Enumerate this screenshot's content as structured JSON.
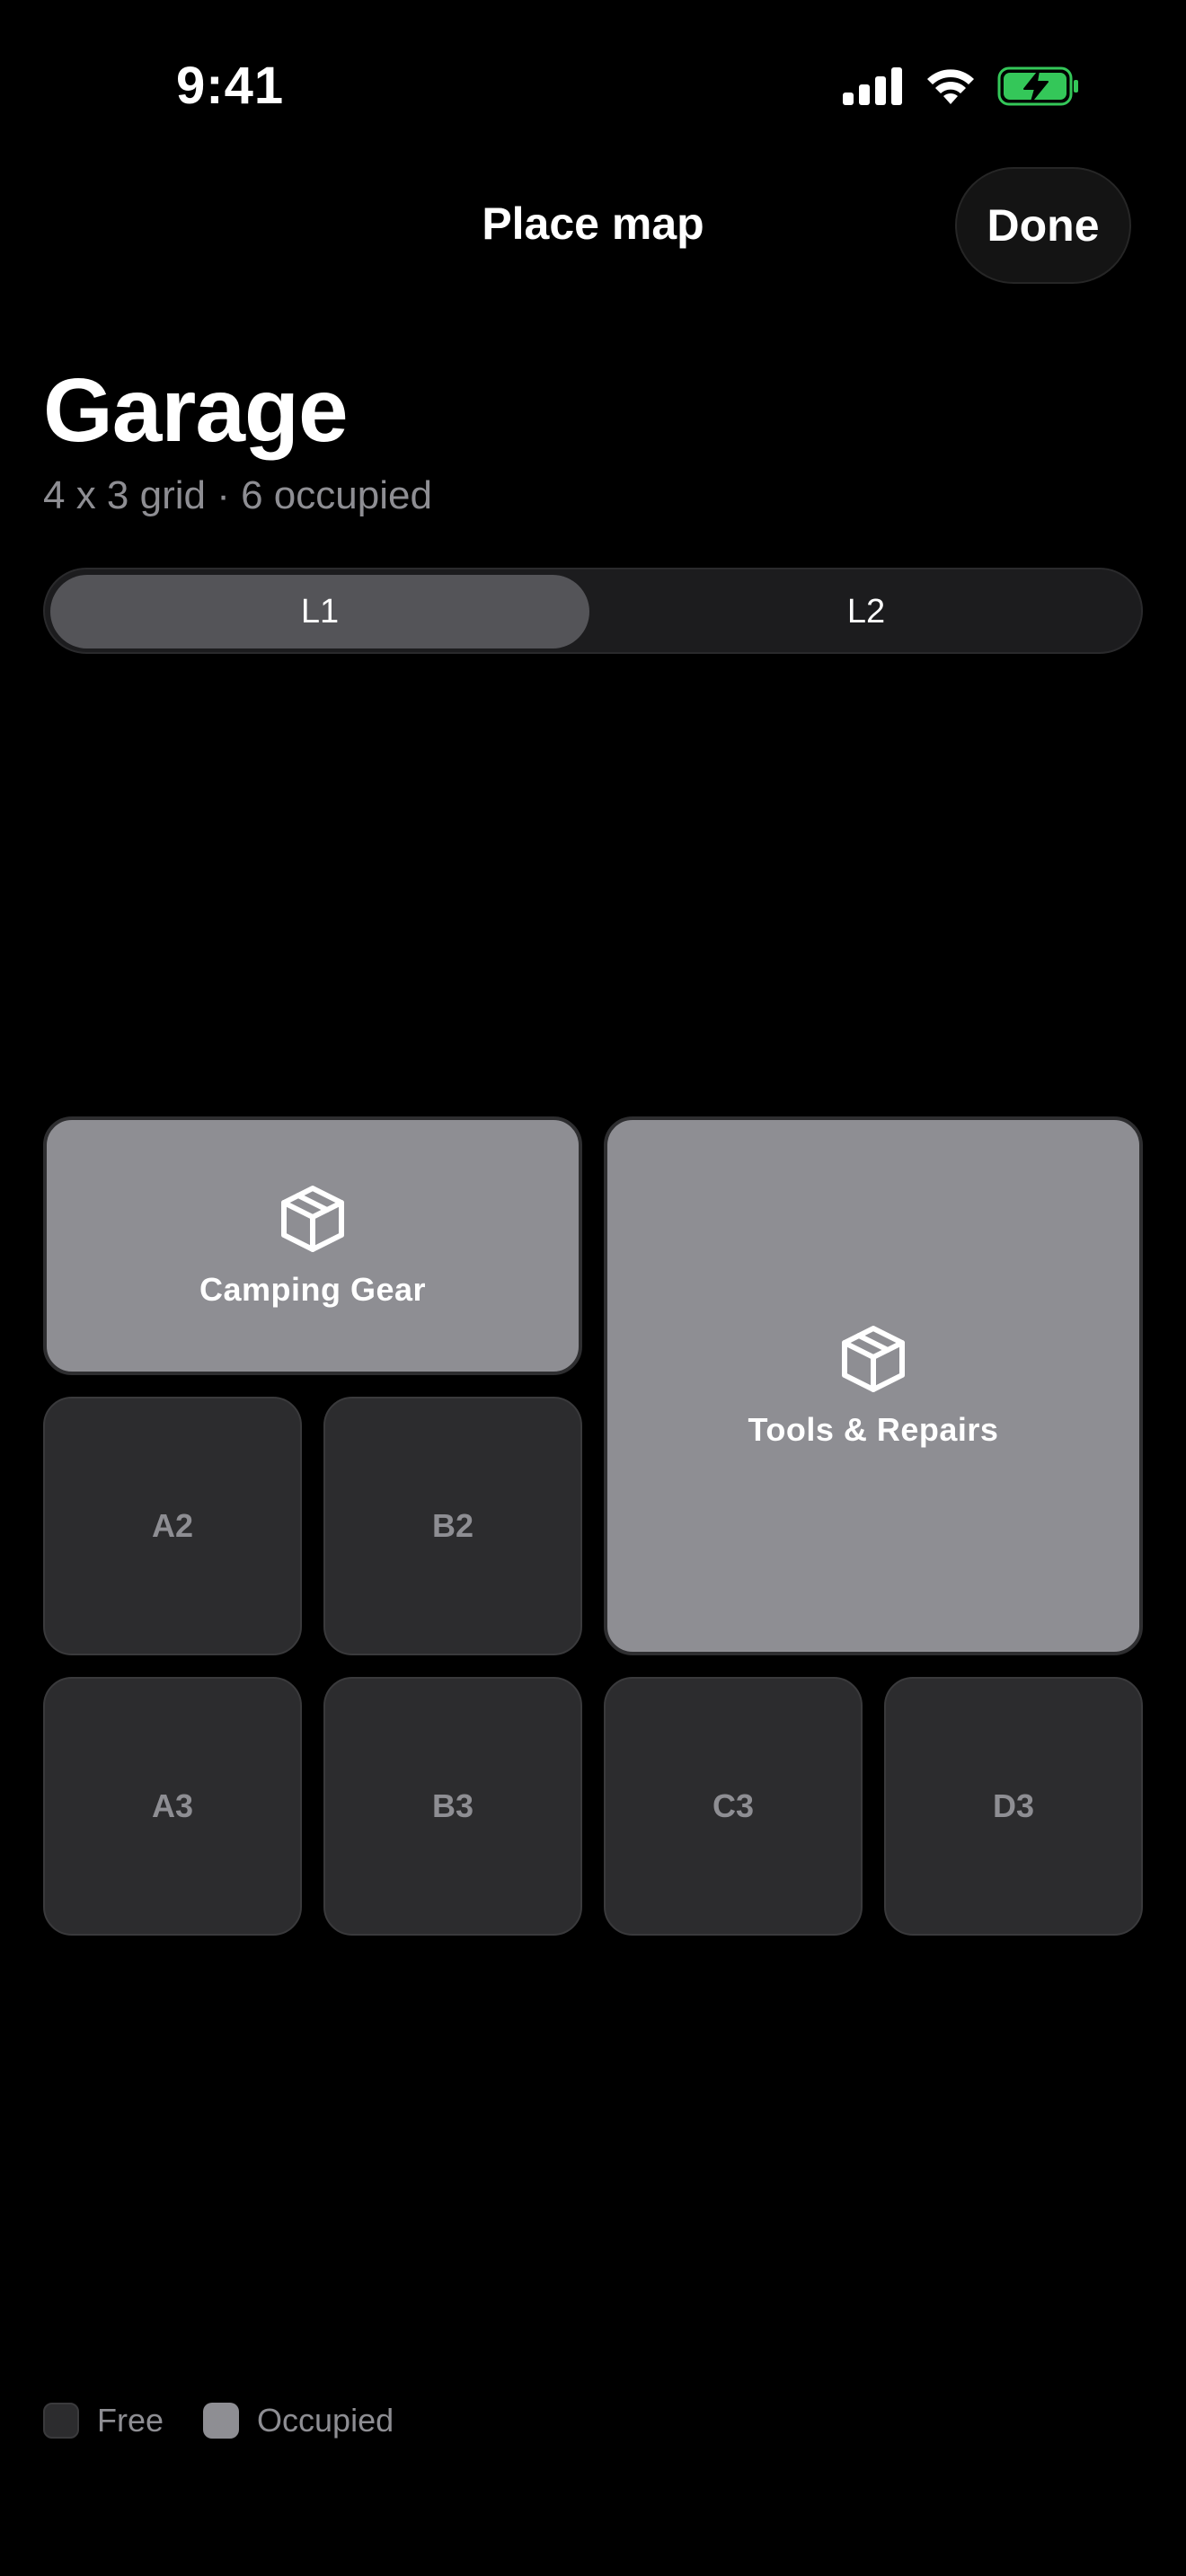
{
  "status_bar": {
    "time": "9:41",
    "battery_color": "#34c759"
  },
  "nav": {
    "title": "Place map",
    "done_label": "Done"
  },
  "place": {
    "name": "Garage",
    "summary": "4 x 3 grid · 6 occupied"
  },
  "levels": {
    "selected": "L1",
    "items": [
      {
        "label": "L1"
      },
      {
        "label": "L2"
      }
    ]
  },
  "grid": {
    "columns": 4,
    "rows": 3,
    "occupied": [
      {
        "label": "Camping Gear",
        "icon": "box-icon"
      },
      {
        "label": "Tools & Repairs",
        "icon": "box-icon"
      }
    ],
    "free": [
      "A2",
      "B2",
      "A3",
      "B3",
      "C3",
      "D3"
    ]
  },
  "legend": {
    "free_label": "Free",
    "occupied_label": "Occupied"
  },
  "colors": {
    "free_cell": "#2c2c2e",
    "occupied_cell": "#8e8e93",
    "background": "#000000"
  }
}
